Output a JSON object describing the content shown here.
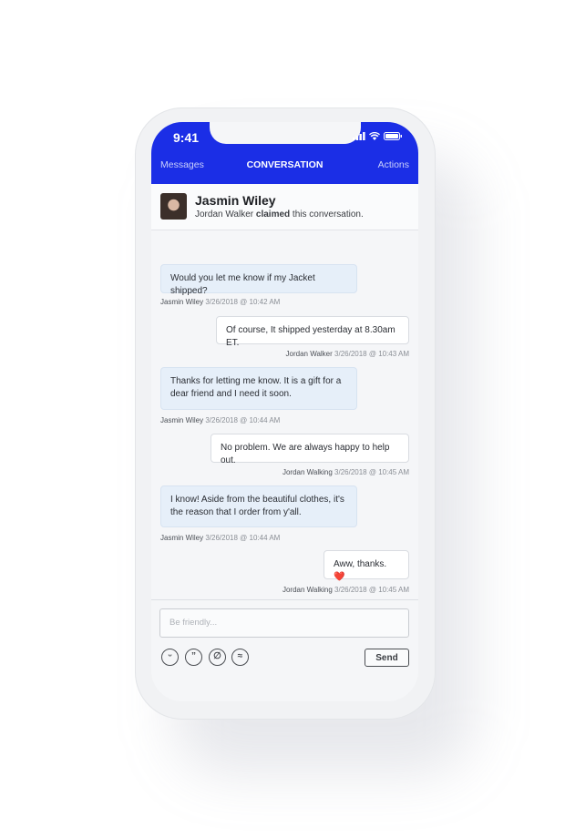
{
  "status_bar": {
    "time": "9:41"
  },
  "nav": {
    "back": "Messages",
    "title": "CONVERSATION",
    "actions": "Actions"
  },
  "contact": {
    "name": "Jasmin Wiley",
    "claimed_by": "Jordan Walker",
    "claimed_word": "claimed",
    "claimed_suffix": "this conversation."
  },
  "messages": [
    {
      "direction": "in",
      "text": "Would you let me know if my Jacket shipped?",
      "sender": "Jasmin Wiley",
      "timestamp": "3/26/2018 @ 10:42 AM"
    },
    {
      "direction": "out",
      "text": "Of course, It shipped yesterday at 8.30am ET.",
      "sender": "Jordan Walker",
      "timestamp": "3/26/2018 @ 10:43 AM"
    },
    {
      "direction": "in",
      "text": "Thanks for letting me know. It is a gift for a dear friend and I need it soon.",
      "sender": "Jasmin Wiley",
      "timestamp": "3/26/2018 @ 10:44 AM"
    },
    {
      "direction": "out",
      "text": "No problem. We are always happy to help out.",
      "sender": "Jordan Walking",
      "timestamp": "3/26/2018 @ 10:45 AM"
    },
    {
      "direction": "in",
      "text": "I know! Aside from the beautiful clothes, it's the reason that I order from y'all.",
      "sender": "Jasmin Wiley",
      "timestamp": "3/26/2018 @ 10:44 AM"
    },
    {
      "direction": "out",
      "text": "Aww, thanks. ❤️",
      "sender": "Jordan Walking",
      "timestamp": "3/26/2018 @ 10:45 AM"
    }
  ],
  "composer": {
    "placeholder": "Be friendly...",
    "send_label": "Send",
    "tools": [
      "emoji-icon",
      "quote-icon",
      "attachment-icon",
      "wave-icon"
    ]
  },
  "colors": {
    "accent": "#1b2ee6",
    "incoming_bubble": "#e6eff9",
    "outgoing_bubble": "#ffffff"
  }
}
